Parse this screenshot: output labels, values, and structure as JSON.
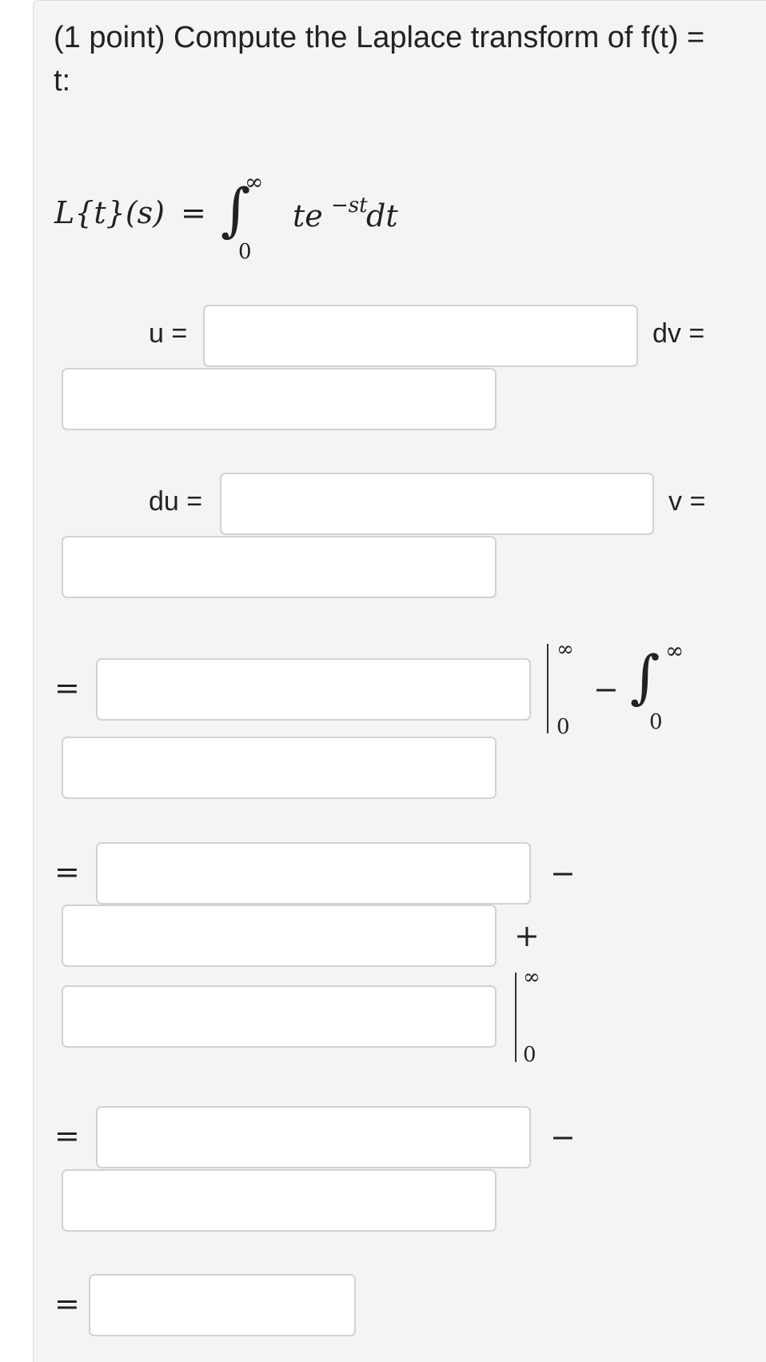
{
  "question": {
    "line1": "(1 point) Compute the Laplace transform of f(t) =",
    "line2": "t:"
  },
  "laplace_eq": {
    "lhs": "L{t}(s)",
    "equals": "=",
    "integral_sign": "∫",
    "upper": "∞",
    "lower": "0",
    "integrand_base": "te",
    "integrand_exp": "−st",
    "differential": "dt"
  },
  "parts": {
    "u_label": "u =",
    "dv_label": "dv =",
    "du_label": "du =",
    "v_label": "v ="
  },
  "step1": {
    "equals": "=",
    "eval_upper": "∞",
    "eval_lower": "0",
    "minus": "−",
    "integral_sign": "∫",
    "int_upper": "∞",
    "int_lower": "0"
  },
  "step2": {
    "equals": "=",
    "minus": "−",
    "plus": "+",
    "eval_upper": "∞",
    "eval_lower": "0"
  },
  "step3": {
    "equals": "=",
    "minus": "−"
  },
  "step4": {
    "equals": "="
  },
  "inputs": {
    "u": "",
    "dv": "",
    "du": "",
    "v": "",
    "s1a": "",
    "s1b": "",
    "s2a": "",
    "s2b": "",
    "s2c": "",
    "s3a": "",
    "s3b": "",
    "final": ""
  }
}
